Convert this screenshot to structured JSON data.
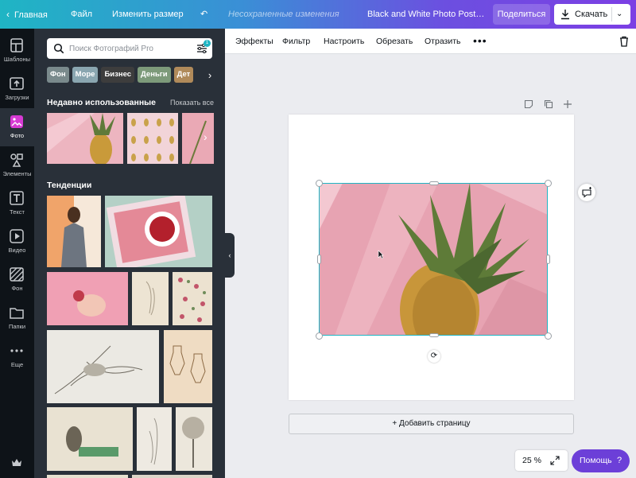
{
  "topbar": {
    "home": "Главная",
    "file": "Файл",
    "resize": "Изменить размер",
    "unsaved": "Несохраненные изменения",
    "title": "Black and White Photo Post, к...",
    "share": "Поделиться",
    "download": "Скачать"
  },
  "rail": [
    {
      "label": "Шаблоны",
      "icon": "layout-icon"
    },
    {
      "label": "Загрузки",
      "icon": "upload-icon"
    },
    {
      "label": "Фото",
      "icon": "photo-icon"
    },
    {
      "label": "Элементы",
      "icon": "shapes-icon"
    },
    {
      "label": "Текст",
      "icon": "text-icon"
    },
    {
      "label": "Видео",
      "icon": "video-icon"
    },
    {
      "label": "Фон",
      "icon": "background-icon"
    },
    {
      "label": "Папки",
      "icon": "folder-icon"
    },
    {
      "label": "Еще",
      "icon": "more-dots-icon"
    }
  ],
  "panel": {
    "search_placeholder": "Поиск Фотографий Pro",
    "filter_badge": "1",
    "chips": [
      {
        "label": "Фон",
        "color": "#7a8a8c"
      },
      {
        "label": "Море",
        "color": "#8aa6b0"
      },
      {
        "label": "Бизнес",
        "color": "#3d3d3d"
      },
      {
        "label": "Деньги",
        "color": "#7d9a7a"
      },
      {
        "label": "Дет",
        "color": "#b08a5a"
      }
    ],
    "recent_title": "Недавно использованные",
    "recent_link": "Показать все",
    "trends_title": "Тенденции"
  },
  "toolbar": {
    "items": [
      "Эффекты",
      "Фильтр",
      "Настроить",
      "Обрезать",
      "Отразить"
    ]
  },
  "canvas": {
    "add_page": "+ Добавить страницу",
    "zoom": "25 %",
    "help": "Помощь",
    "help_q": "?"
  },
  "colors": {
    "accent": "#1fb5c4",
    "rail_bg": "#0e1318",
    "panel_bg": "#293039",
    "help_bg": "#6c3fd8",
    "photo_pink": "#e9a5b4"
  }
}
